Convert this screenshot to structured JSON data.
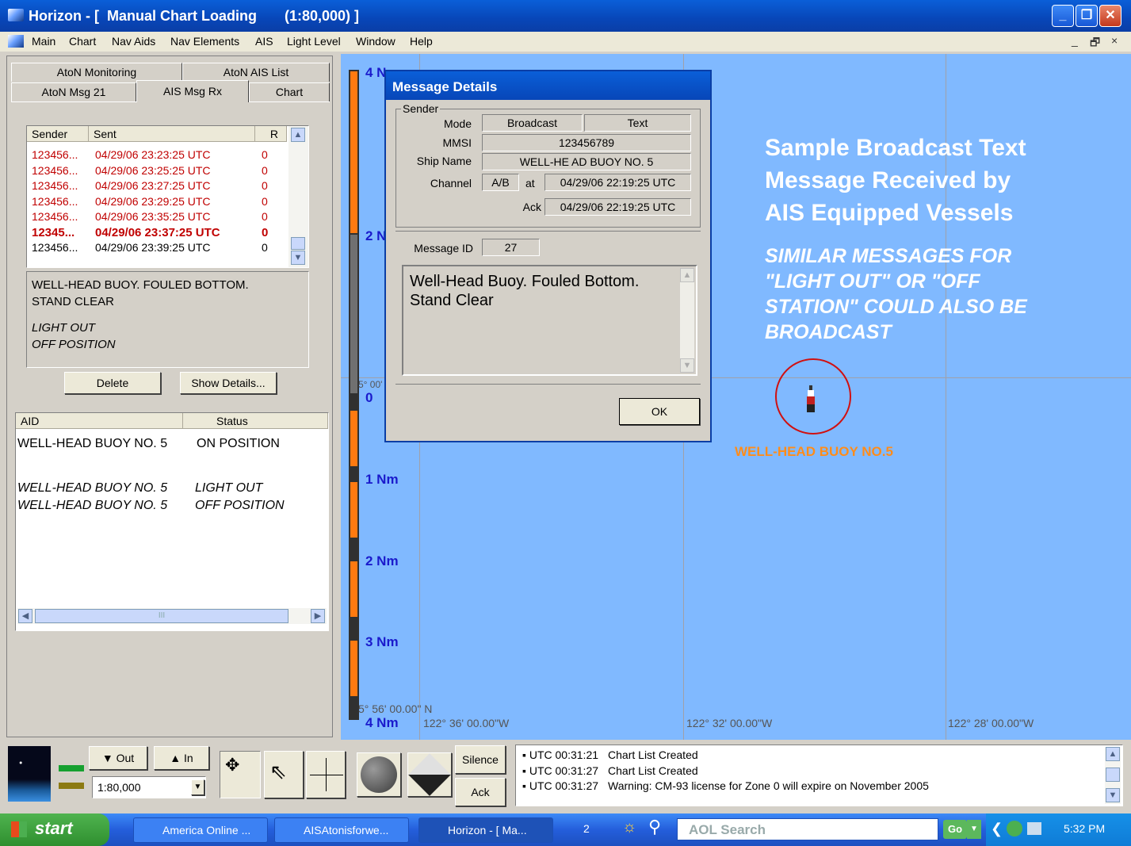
{
  "window": {
    "title": "Horizon - [  Manual Chart Loading       (1:80,000) ]",
    "min_label": "_",
    "max_label": "❐",
    "close_label": "✕"
  },
  "menu": {
    "items": [
      "Main",
      "Chart",
      "Nav Aids",
      "Nav Elements",
      "AIS",
      "Light Level",
      "Window",
      "Help"
    ],
    "mdi_controls": [
      "_",
      "🗗",
      "×"
    ]
  },
  "left": {
    "tabs_row1": [
      "AtoN Monitoring",
      "AtoN AIS List"
    ],
    "tabs_row2": [
      "AtoN Msg 21",
      "AIS Msg Rx",
      "Chart"
    ],
    "active_tab": "AIS Msg Rx",
    "messages": {
      "headers": [
        "Sender",
        "Sent",
        "R"
      ],
      "rows": [
        {
          "sender": "123456...",
          "sent": "04/29/06 23:23:25 UTC",
          "r": "0",
          "style": "red"
        },
        {
          "sender": "123456...",
          "sent": "04/29/06 23:25:25 UTC",
          "r": "0",
          "style": "red"
        },
        {
          "sender": "123456...",
          "sent": "04/29/06 23:27:25 UTC",
          "r": "0",
          "style": "red"
        },
        {
          "sender": "123456...",
          "sent": "04/29/06 23:29:25 UTC",
          "r": "0",
          "style": "red"
        },
        {
          "sender": "123456...",
          "sent": "04/29/06 23:35:25 UTC",
          "r": "0",
          "style": "red"
        },
        {
          "sender": "12345...",
          "sent": "04/29/06 23:37:25 UTC",
          "r": "0",
          "style": "bold-red"
        },
        {
          "sender": "123456...",
          "sent": "04/29/06 23:39:25 UTC",
          "r": "0",
          "style": "black"
        }
      ]
    },
    "message_text": {
      "line1": "WELL-HEAD BUOY.  FOULED BOTTOM.",
      "line2": "STAND CLEAR",
      "line3": "LIGHT OUT",
      "line4": "OFF POSITION"
    },
    "buttons": {
      "delete": "Delete",
      "show_details": "Show Details..."
    },
    "aid_list": {
      "headers": [
        "AID",
        "Status"
      ],
      "rows": [
        {
          "aid": "WELL-HEAD BUOY NO. 5",
          "status": "ON POSITION",
          "italic": false
        },
        {
          "aid": "WELL-HEAD BUOY NO. 5",
          "status": "LIGHT OUT",
          "italic": true
        },
        {
          "aid": "WELL-HEAD BUOY NO. 5",
          "status": "OFF POSITION",
          "italic": true
        }
      ],
      "scroll_grip": "III"
    }
  },
  "chart": {
    "scale_labels": [
      "4 N",
      "2 N",
      "0",
      "1 Nm",
      "2 Nm",
      "3 Nm",
      "4 Nm"
    ],
    "lat_label_mid": "5° 00'",
    "lat_label_bottom": "5° 56' 00.00\" N",
    "lon_labels": [
      "122° 36' 00.00\"W",
      "122° 32' 00.00\"W",
      "122° 28' 00.00\"W"
    ],
    "annotation": {
      "line1": "Sample Broadcast Text",
      "line2": "Message Received by",
      "line3": "AIS Equipped Vessels",
      "ital1": "SIMILAR MESSAGES FOR",
      "ital2": "\"LIGHT OUT\" OR  \"OFF",
      "ital3": "STATION\" COULD ALSO BE",
      "ital4": "BROADCAST"
    },
    "buoy_label": "WELL-HEAD BUOY NO.5",
    "colors": {
      "sea": "#80b9ff",
      "buoy_circle": "#d01010",
      "buoy_label": "#ff8c1a"
    }
  },
  "dialog": {
    "title": "Message Details",
    "sender_group": "Sender",
    "mode_label": "Mode",
    "mode_values": [
      "Broadcast",
      "Text"
    ],
    "mmsi_label": "MMSI",
    "mmsi": "123456789",
    "ship_label": "Ship Name",
    "ship": "WELL-HE AD BUOY NO. 5",
    "channel_label": "Channel",
    "channel": "A/B",
    "at_label": "at",
    "at_time": "04/29/06 22:19:25 UTC",
    "ack_label": "Ack",
    "ack_time": "04/29/06 22:19:25 UTC",
    "msgid_label": "Message ID",
    "msgid": "27",
    "message_line1": "Well-Head Buoy.  Fouled Bottom.",
    "message_line2": "Stand Clear",
    "ok": "OK"
  },
  "toolbar": {
    "out": "Out",
    "in": "In",
    "scale": "1:80,000",
    "silence": "Silence",
    "ack": "Ack",
    "log": [
      {
        "time": "UTC 00:31:21",
        "text": "Chart List Created"
      },
      {
        "time": "UTC 00:31:27",
        "text": "Chart List Created"
      },
      {
        "time": "UTC 00:31:27",
        "text": "Warning: CM-93 license for Zone 0 will expire on November 2005"
      }
    ]
  },
  "taskbar": {
    "start": "start",
    "tasks": [
      "America Online ...",
      "AISAtonisforwe...",
      "Horizon - [ Ma..."
    ],
    "tray_count": "2",
    "search_label": "AOL Search",
    "go": "Go",
    "clock": "5:32 PM"
  }
}
